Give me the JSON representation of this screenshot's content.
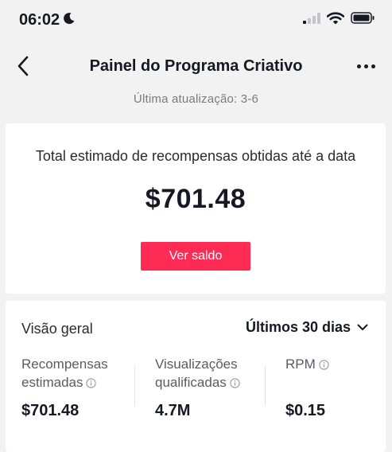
{
  "status": {
    "time": "06:02"
  },
  "nav": {
    "title": "Painel do Programa Criativo"
  },
  "updated": "Última atualização: 3-6",
  "total": {
    "label": "Total estimado de recompensas obtidas até a data",
    "amount": "$701.48",
    "button": "Ver saldo"
  },
  "overview": {
    "title": "Visão geral",
    "period": "Últimos 30 dias",
    "metrics": [
      {
        "label_line1": "Recompensas",
        "label_line2": "estimadas",
        "value": "$701.48"
      },
      {
        "label_line1": "Visualizações",
        "label_line2": "qualificadas",
        "value": "4.7M"
      },
      {
        "label_line1": "RPM",
        "label_line2": "",
        "value": "$0.15"
      }
    ]
  },
  "colors": {
    "accent": "#fe2c55",
    "text": "#161823",
    "muted": "#7a7b80",
    "background": "#f2f2f2"
  },
  "icons": [
    "moon-icon",
    "signal-icon",
    "wifi-icon",
    "battery-icon",
    "back-arrow-icon",
    "more-icon",
    "chevron-down-icon",
    "info-icon"
  ]
}
